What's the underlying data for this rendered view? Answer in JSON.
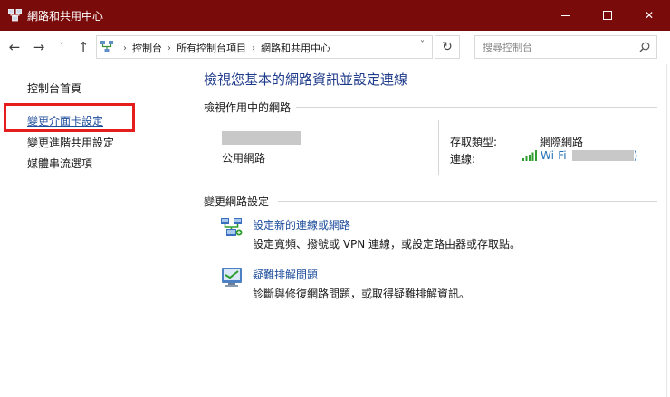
{
  "window": {
    "title": "網路和共用中心",
    "minimize_icon": "minimize-icon",
    "maximize_icon": "maximize-icon",
    "close_glyph": "✕"
  },
  "nav": {
    "back_glyph": "←",
    "forward_glyph": "→",
    "recent_glyph": "˅",
    "up_glyph": "↑",
    "breadcrumbs": [
      "控制台",
      "所有控制台項目",
      "網路和共用中心"
    ],
    "breadcrumb_separator": "›",
    "dropdown_glyph": "˅",
    "refresh_glyph": "↻",
    "search_placeholder": "搜尋控制台"
  },
  "sidebar": {
    "items": [
      {
        "label": "控制台首頁"
      },
      {
        "label": "變更介面卡設定",
        "highlighted": true
      },
      {
        "label": "變更進階共用設定"
      },
      {
        "label": "媒體串流選項"
      }
    ]
  },
  "main": {
    "title": "檢視您基本的網路資訊並設定連線",
    "active_networks": {
      "section_label": "檢視作用中的網路",
      "network_type": "公用網路",
      "access_type_label": "存取類型:",
      "access_type_value": "網際網路",
      "connection_label": "連線:",
      "connection_value": "Wi-Fi",
      "connection_suffix": ")"
    },
    "change_settings": {
      "section_label": "變更網路設定",
      "tasks": [
        {
          "link": "設定新的連線或網路",
          "description": "設定寬頻、撥號或 VPN 連線，或設定路由器或存取點。",
          "icon": "network-setup-icon"
        },
        {
          "link": "疑難排解問題",
          "description": "診斷與修復網路問題，或取得疑難排解資訊。",
          "icon": "troubleshoot-icon"
        }
      ]
    }
  },
  "colors": {
    "titlebar": "#7a0b0b",
    "link": "#1f4e9c",
    "title": "#1e3a8a",
    "highlight_box": "#e51d1d",
    "wifi_link": "#1f6fb8"
  }
}
